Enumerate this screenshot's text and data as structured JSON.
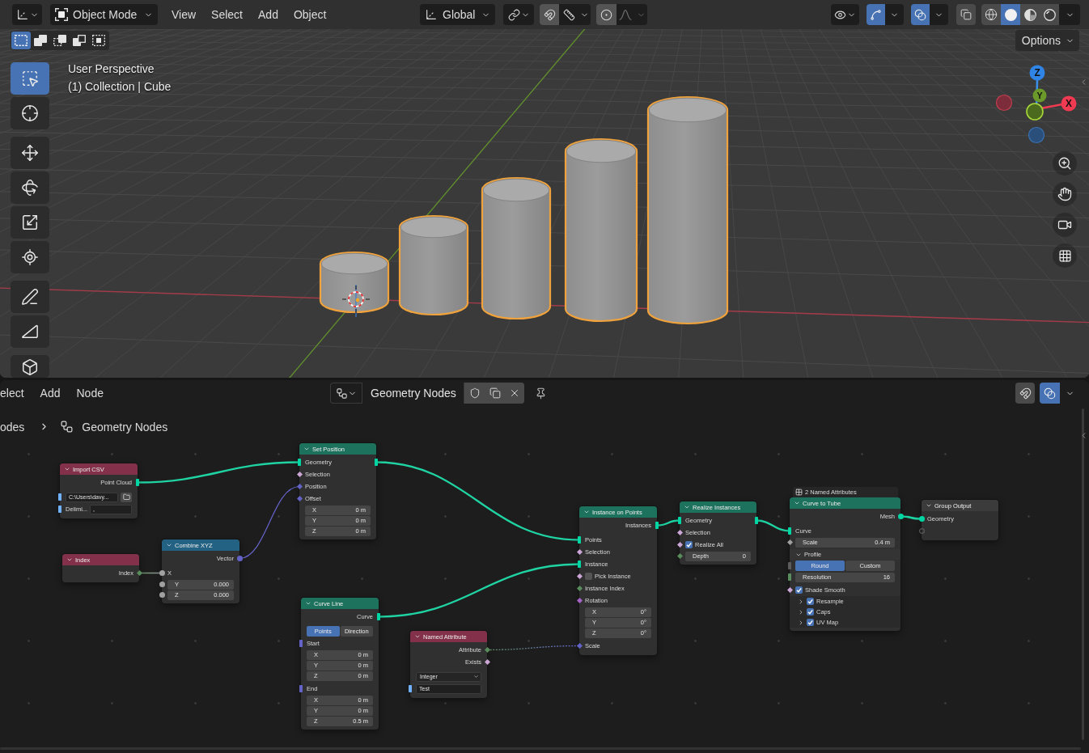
{
  "viewport_header": {
    "mode": "Object Mode",
    "menus": [
      "View",
      "Select",
      "Add",
      "Object"
    ],
    "orientation": "Global",
    "snapping": {
      "on": false
    },
    "proportional_editing": {
      "on": false
    },
    "gizmos": {
      "on": true
    },
    "overlays": {
      "on": true
    },
    "xray": {
      "on": false
    },
    "shading": [
      {
        "kind": "wireframe",
        "selected": false
      },
      {
        "kind": "solid",
        "selected": true
      },
      {
        "kind": "material",
        "selected": false
      },
      {
        "kind": "rendered",
        "selected": false
      }
    ]
  },
  "select_modes": [
    {
      "kind": "set",
      "selected": true
    },
    {
      "kind": "extend",
      "selected": false
    },
    {
      "kind": "subtract",
      "selected": false
    },
    {
      "kind": "invert",
      "selected": false
    },
    {
      "kind": "intersect",
      "selected": false
    }
  ],
  "options_button": "Options",
  "viewport_info": [
    "User Perspective",
    "(1) Collection | Cube"
  ],
  "toolbar": [
    {
      "tools": [
        {
          "kind": "select_box",
          "selected": true
        },
        {
          "kind": "cursor",
          "selected": false
        }
      ]
    },
    {
      "tools": [
        {
          "kind": "move",
          "selected": false
        },
        {
          "kind": "rotate",
          "selected": false
        },
        {
          "kind": "scale",
          "selected": false
        },
        {
          "kind": "transform",
          "selected": false
        }
      ]
    },
    {
      "tools": [
        {
          "kind": "annotate",
          "selected": false
        },
        {
          "kind": "measure",
          "selected": false
        }
      ]
    },
    {
      "tools": [
        {
          "kind": "add_cube",
          "selected": false
        }
      ]
    }
  ],
  "navigation_gizmo": {
    "axes": [
      {
        "label": "Z"
      },
      {
        "label": "Y"
      },
      {
        "label": "X"
      }
    ]
  },
  "scene_objects": [
    {
      "selected": true
    },
    {
      "selected": true
    },
    {
      "selected": true
    },
    {
      "selected": true
    },
    {
      "selected": true
    }
  ],
  "node_editor": {
    "menus": [
      "elect",
      "Add",
      "Node"
    ],
    "node_group": "Geometry Nodes",
    "snapping": {
      "on": false
    },
    "overlays": {
      "on": true
    },
    "breadcrumbs": [
      "odes",
      "Geometry Nodes"
    ],
    "nodes": [
      {
        "title": "Import CSV",
        "color": "#83314a",
        "rows": [
          {
            "kind": "output",
            "label": "Point Cloud",
            "socket": {
              "kind": "bar",
              "color": "#00d6a3"
            }
          },
          {
            "kind": "path",
            "value": "C:\\Users\\davy...",
            "socket": {
              "kind": "bar",
              "color": "#70b2ff"
            }
          },
          {
            "kind": "text",
            "label": "Delimi...",
            "value": ",",
            "socket": {
              "kind": "bar",
              "color": "#70b2ff"
            }
          }
        ]
      },
      {
        "title": "Index",
        "color": "#83314a",
        "rows": [
          {
            "kind": "output",
            "label": "Index",
            "socket": {
              "kind": "diamond",
              "color": "#598c5c"
            }
          }
        ]
      },
      {
        "title": "Combine XYZ",
        "color": "#246283",
        "rows": [
          {
            "kind": "output",
            "label": "Vector",
            "socket": {
              "kind": "dot",
              "color": "#6363c7"
            }
          },
          {
            "kind": "input",
            "label": "X",
            "socket": {
              "kind": "dot",
              "color": "#a1a1a1"
            }
          },
          {
            "kind": "number",
            "label": "Y",
            "value": "0.000",
            "socket": {
              "kind": "dot",
              "color": "#a1a1a1"
            }
          },
          {
            "kind": "number",
            "label": "Z",
            "value": "0.000",
            "socket": {
              "kind": "dot",
              "color": "#a1a1a1"
            }
          }
        ]
      },
      {
        "title": "Set Position",
        "color": "#1d725e",
        "rows": [
          {
            "kind": "input",
            "label": "Geometry",
            "socket": {
              "kind": "bar",
              "color": "#00d6a3"
            },
            "out_socket": {
              "kind": "bar",
              "color": "#00d6a3"
            }
          },
          {
            "kind": "input",
            "label": "Selection",
            "socket": {
              "kind": "diamond",
              "color": "#cca6d6"
            }
          },
          {
            "kind": "input",
            "label": "Position",
            "socket": {
              "kind": "diamond",
              "color": "#6363c7"
            }
          },
          {
            "kind": "input",
            "label": "Offset",
            "socket": {
              "kind": "diamond",
              "color": "#6363c7"
            }
          },
          {
            "kind": "number",
            "label": "X",
            "value": "0 m"
          },
          {
            "kind": "number",
            "label": "Y",
            "value": "0 m"
          },
          {
            "kind": "number",
            "label": "Z",
            "value": "0 m"
          }
        ]
      },
      {
        "title": "Curve Line",
        "color": "#1d725e",
        "rows": [
          {
            "kind": "output",
            "label": "Curve",
            "socket": {
              "kind": "bar",
              "color": "#00d6a3"
            }
          },
          {
            "kind": "toggle",
            "options": [
              {
                "label": "Points",
                "selected": true
              },
              {
                "label": "Direction",
                "selected": false
              }
            ]
          },
          {
            "kind": "input",
            "label": "Start",
            "socket": {
              "kind": "bar",
              "color": "#6363c7"
            }
          },
          {
            "kind": "number",
            "label": "X",
            "value": "0 m"
          },
          {
            "kind": "number",
            "label": "Y",
            "value": "0 m"
          },
          {
            "kind": "number",
            "label": "Z",
            "value": "0 m"
          },
          {
            "kind": "input",
            "label": "End",
            "socket": {
              "kind": "bar",
              "color": "#6363c7"
            }
          },
          {
            "kind": "number",
            "label": "X",
            "value": "0 m"
          },
          {
            "kind": "number",
            "label": "Y",
            "value": "0 m"
          },
          {
            "kind": "number",
            "label": "Z",
            "value": "0.5 m"
          }
        ]
      },
      {
        "title": "Named Attribute",
        "color": "#83314a",
        "rows": [
          {
            "kind": "output",
            "label": "Attribute",
            "socket": {
              "kind": "diamond",
              "color": "#598c5c"
            }
          },
          {
            "kind": "output",
            "label": "Exists",
            "socket": {
              "kind": "diamond",
              "color": "#cca6d6"
            }
          },
          {
            "kind": "dropdown",
            "value": "Integer"
          },
          {
            "kind": "text",
            "value": "Test",
            "socket": {
              "kind": "bar",
              "color": "#70b2ff"
            }
          }
        ]
      },
      {
        "title": "Instance on Points",
        "color": "#1d725e",
        "rows": [
          {
            "kind": "output",
            "label": "Instances",
            "socket": {
              "kind": "bar",
              "color": "#00d6a3"
            }
          },
          {
            "kind": "input",
            "label": "Points",
            "socket": {
              "kind": "bar",
              "color": "#00d6a3"
            }
          },
          {
            "kind": "input",
            "label": "Selection",
            "socket": {
              "kind": "diamond",
              "color": "#cca6d6"
            }
          },
          {
            "kind": "input",
            "label": "Instance",
            "socket": {
              "kind": "bar",
              "color": "#00d6a3"
            }
          },
          {
            "kind": "checkbox",
            "label": "Pick Instance",
            "checked": false,
            "socket": {
              "kind": "diamond",
              "color": "#cca6d6"
            }
          },
          {
            "kind": "input",
            "label": "Instance Index",
            "socket": {
              "kind": "diamond",
              "color": "#598c5c"
            }
          },
          {
            "kind": "input",
            "label": "Rotation",
            "socket": {
              "kind": "diamond",
              "color": "#a663c7"
            }
          },
          {
            "kind": "number",
            "label": "X",
            "value": "0°"
          },
          {
            "kind": "number",
            "label": "Y",
            "value": "0°"
          },
          {
            "kind": "number",
            "label": "Z",
            "value": "0°"
          },
          {
            "kind": "input",
            "label": "Scale",
            "socket": {
              "kind": "diamond",
              "color": "#6363c7"
            }
          }
        ]
      },
      {
        "title": "Realize Instances",
        "color": "#1d725e",
        "rows": [
          {
            "kind": "input",
            "label": "Geometry",
            "socket": {
              "kind": "bar",
              "color": "#00d6a3"
            },
            "out_socket": {
              "kind": "bar",
              "color": "#00d6a3"
            }
          },
          {
            "kind": "input",
            "label": "Selection",
            "socket": {
              "kind": "diamond",
              "color": "#cca6d6"
            }
          },
          {
            "kind": "checkbox",
            "label": "Realize All",
            "checked": true,
            "socket": {
              "kind": "diamond",
              "color": "#cca6d6"
            }
          },
          {
            "kind": "number",
            "label": "Depth",
            "value": "0",
            "socket": {
              "kind": "diamond",
              "color": "#598c5c"
            }
          }
        ]
      },
      {
        "title": "Curve to Tube",
        "color": "#1d725e",
        "badge": "2 Named Attributes",
        "rows": [
          {
            "kind": "output",
            "label": "Mesh",
            "socket": {
              "kind": "dot",
              "color": "#00d6a3"
            }
          },
          {
            "kind": "input",
            "label": "Curve",
            "socket": {
              "kind": "bar",
              "color": "#00d6a3"
            }
          },
          {
            "kind": "number",
            "label": "Scale",
            "value": "0.4 m",
            "socket": {
              "kind": "diamond",
              "color": "#a1a1a1"
            }
          },
          {
            "kind": "panel",
            "label": "Profile",
            "expanded": true
          },
          {
            "kind": "toggle",
            "options": [
              {
                "label": "Round",
                "selected": true
              },
              {
                "label": "Custom",
                "selected": false
              }
            ],
            "socket": {
              "kind": "bar",
              "color": "#5c5c5c"
            }
          },
          {
            "kind": "number",
            "label": "Resolution",
            "value": "16",
            "socket": {
              "kind": "bar",
              "color": "#598c5c"
            }
          },
          {
            "kind": "checkbox",
            "label": "Shade Smooth",
            "checked": true,
            "socket": {
              "kind": "diamond",
              "color": "#cca6d6"
            }
          },
          {
            "kind": "panel",
            "label": "Resample",
            "expanded": false,
            "checked": true
          },
          {
            "kind": "panel",
            "label": "Caps",
            "expanded": false,
            "checked": true
          },
          {
            "kind": "panel",
            "label": "UV Map",
            "expanded": false,
            "checked": true
          }
        ]
      },
      {
        "title": "Group Output",
        "color": "#3b3b3b",
        "rows": [
          {
            "kind": "input",
            "label": "Geometry",
            "socket": {
              "kind": "dot",
              "color": "#00d6a3"
            }
          },
          {
            "kind": "virtual"
          }
        ]
      }
    ]
  }
}
